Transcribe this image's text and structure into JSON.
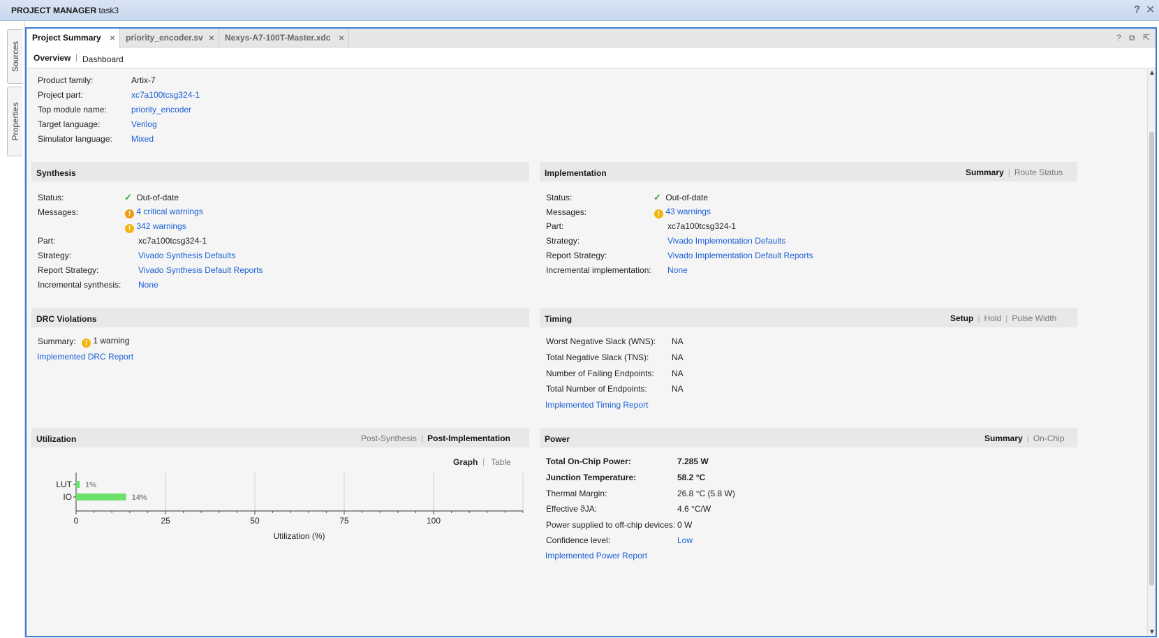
{
  "titlebar": {
    "title": "PROJECT MANAGER",
    "subtitle": "- task3",
    "help": "?",
    "close": "✕"
  },
  "lefttabs": {
    "sources": "Sources",
    "properties": "Properties"
  },
  "tabs": [
    {
      "label": "Project Summary",
      "close": "×"
    },
    {
      "label": "priority_encoder.sv",
      "close": "×"
    },
    {
      "label": "Nexys-A7-100T-Master.xdc",
      "close": "×"
    }
  ],
  "tab_icons": {
    "help": "?",
    "restore": "⧉",
    "float": "⇱"
  },
  "subnav": {
    "overview": "Overview",
    "separator": "|",
    "dashboard": "Dashboard"
  },
  "project": {
    "family_label": "Product family:",
    "family": "Artix-7",
    "part_label": "Project part:",
    "part": "xc7a100tcsg324-1",
    "top_label": "Top module name:",
    "top": "priority_encoder",
    "lang_label": "Target language:",
    "lang": "Verilog",
    "sim_label": "Simulator language:",
    "sim": "Mixed"
  },
  "synthesis": {
    "title": "Synthesis",
    "status_label": "Status:",
    "status": "Out-of-date",
    "messages_label": "Messages:",
    "critical": "4 critical warnings",
    "warnings": "342 warnings",
    "part_label": "Part:",
    "part": "xc7a100tcsg324-1",
    "strategy_label": "Strategy:",
    "strategy": "Vivado Synthesis Defaults",
    "report_label": "Report Strategy:",
    "report": "Vivado Synthesis Default Reports",
    "incr_label": "Incremental synthesis:",
    "incr": "None"
  },
  "implementation": {
    "title": "Implementation",
    "opt1": "Summary",
    "sep": "|",
    "opt2": "Route Status",
    "status_label": "Status:",
    "status": "Out-of-date",
    "messages_label": "Messages:",
    "warnings": "43 warnings",
    "part_label": "Part:",
    "part": "xc7a100tcsg324-1",
    "strategy_label": "Strategy:",
    "strategy": "Vivado Implementation Defaults",
    "report_label": "Report Strategy:",
    "report": "Vivado Implementation Default Reports",
    "incr_label": "Incremental implementation:",
    "incr": "None"
  },
  "drc": {
    "title": "DRC Violations",
    "summary_label": "Summary:",
    "summary": "1 warning",
    "report_link": "Implemented DRC Report"
  },
  "timing": {
    "title": "Timing",
    "opt1": "Setup",
    "opt2": "Hold",
    "opt3": "Pulse Width",
    "sep": "|",
    "wns_label": "Worst Negative Slack (WNS):",
    "wns": "NA",
    "tns_label": "Total Negative Slack (TNS):",
    "tns": "NA",
    "fail_label": "Number of Failing Endpoints:",
    "fail": "NA",
    "total_label": "Total Number of Endpoints:",
    "total": "NA",
    "report_link": "Implemented Timing Report"
  },
  "utilization": {
    "title": "Utilization",
    "opt1": "Post-Synthesis",
    "sep": "|",
    "opt2": "Post-Implementation",
    "view1": "Graph",
    "view2": "Table"
  },
  "power": {
    "title": "Power",
    "opt1": "Summary",
    "sep": "|",
    "opt2": "On-Chip",
    "total_label": "Total On-Chip Power:",
    "total": "7.285 W",
    "junction_label": "Junction Temperature:",
    "junction": "58.2 °C",
    "margin_label": "Thermal Margin:",
    "margin": "26.8 °C (5.8 W)",
    "theta_label": "Effective ϑJA:",
    "theta": "4.6 °C/W",
    "offchip_label": "Power supplied to off-chip devices:",
    "offchip": "0 W",
    "conf_label": "Confidence level:",
    "conf": "Low",
    "report_link": "Implemented Power Report"
  },
  "chart_data": {
    "type": "bar",
    "orientation": "horizontal",
    "categories": [
      "LUT",
      "IO"
    ],
    "values": [
      1,
      14
    ],
    "value_labels": [
      "1%",
      "14%"
    ],
    "xlabel": "Utilization (%)",
    "xticks": [
      "0",
      "25",
      "50",
      "75",
      "100"
    ],
    "xlim": [
      0,
      125
    ],
    "grid": true,
    "color": "#6be06b"
  }
}
